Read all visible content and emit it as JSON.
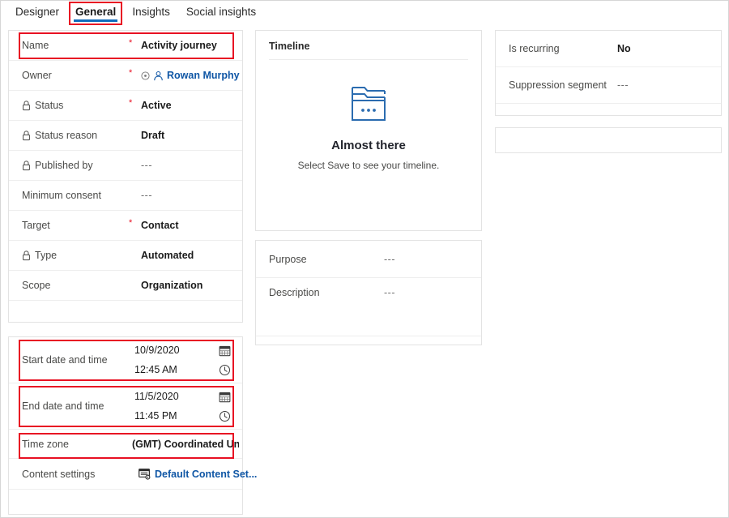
{
  "tabs": [
    {
      "label": "Designer",
      "active": false,
      "highlighted": false
    },
    {
      "label": "General",
      "active": true,
      "highlighted": true
    },
    {
      "label": "Insights",
      "active": false,
      "highlighted": false
    },
    {
      "label": "Social insights",
      "active": false,
      "highlighted": false
    }
  ],
  "main_panel": {
    "rows": [
      {
        "label": "Name",
        "value": "Activity journey",
        "required": true,
        "locked": false,
        "style": "bold",
        "highlighted": true
      },
      {
        "label": "Owner",
        "value": "Rowan Murphy",
        "required": true,
        "locked": false,
        "style": "link",
        "highlighted": false
      },
      {
        "label": "Status",
        "value": "Active",
        "required": true,
        "locked": true,
        "style": "bold",
        "highlighted": false
      },
      {
        "label": "Status reason",
        "value": "Draft",
        "required": false,
        "locked": true,
        "style": "bold",
        "highlighted": false
      },
      {
        "label": "Published by",
        "value": "---",
        "required": false,
        "locked": true,
        "style": "muted",
        "highlighted": false
      },
      {
        "label": "Minimum consent",
        "value": "---",
        "required": false,
        "locked": false,
        "style": "muted",
        "highlighted": false
      },
      {
        "label": "Target",
        "value": "Contact",
        "required": true,
        "locked": false,
        "style": "bold",
        "highlighted": false
      },
      {
        "label": "Type",
        "value": "Automated",
        "required": false,
        "locked": true,
        "style": "bold",
        "highlighted": false
      },
      {
        "label": "Scope",
        "value": "Organization",
        "required": false,
        "locked": false,
        "style": "bold",
        "highlighted": false
      }
    ]
  },
  "schedule_panel": {
    "start": {
      "label": "Start date and time",
      "date": "10/9/2020",
      "time": "12:45 AM",
      "date_icon": "calendar-icon",
      "time_icon": "clock-icon",
      "highlighted": true
    },
    "end": {
      "label": "End date and time",
      "date": "11/5/2020",
      "time": "11:45 PM",
      "date_icon": "calendar-icon",
      "time_icon": "clock-icon",
      "highlighted": true
    },
    "timezone": {
      "label": "Time zone",
      "value": "(GMT) Coordinated Universal Time",
      "highlighted": true
    },
    "content_settings": {
      "label": "Content settings",
      "value": "Default Content Set...",
      "icon": "content-settings-icon",
      "highlighted": false
    }
  },
  "timeline_panel": {
    "header": "Timeline",
    "empty_icon": "files-stack-icon",
    "empty_title": "Almost there",
    "empty_subtitle": "Select Save to see your timeline."
  },
  "purpose_panel": {
    "rows": [
      {
        "label": "Purpose",
        "value": "---"
      },
      {
        "label": "Description",
        "value": "---"
      }
    ]
  },
  "recurrence_panel": {
    "rows": [
      {
        "label": "Is recurring",
        "value": "No",
        "style": "bold"
      },
      {
        "label": "Suppression segment",
        "value": "---",
        "style": "muted"
      }
    ]
  },
  "empty_panel": {
    "content": ""
  },
  "colors": {
    "accent_blue": "#0f6cbd",
    "link_blue": "#0f56a5",
    "highlight_red": "#e81123",
    "required_red": "#e81123",
    "panel_border": "#e3e3e3",
    "row_divider": "#eeeeee",
    "label_text": "#4a4a48",
    "value_text": "#1b1b1b",
    "muted_text": "#6d6d6d"
  }
}
